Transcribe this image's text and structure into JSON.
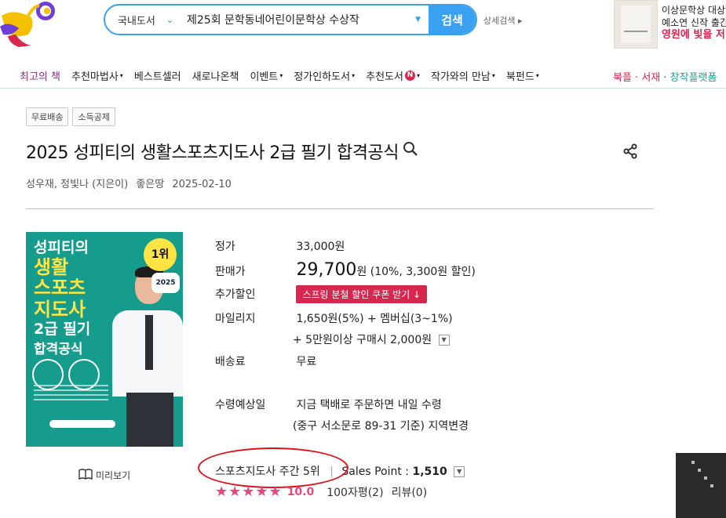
{
  "header": {
    "search": {
      "category": "국내도서",
      "query": "제25회 문학동네어린이문학상 수상작",
      "button": "검색"
    },
    "detail_search": "상세검색 ▸",
    "promo": {
      "line1": "이상문학상 대상",
      "line2": "예소연 신작 출간",
      "line3": "영원에 빛을 저"
    }
  },
  "nav": {
    "items": [
      {
        "label": "최고의 책",
        "caret": ""
      },
      {
        "label": "추천마법사",
        "caret": "▾"
      },
      {
        "label": "베스트셀러",
        "caret": ""
      },
      {
        "label": "새로나온책",
        "caret": ""
      },
      {
        "label": "이벤트",
        "caret": "▾"
      },
      {
        "label": "정가인하도서",
        "caret": "▾"
      },
      {
        "label": "추천도서",
        "caret": "▾",
        "badge": "N"
      },
      {
        "label": "작가와의 만남",
        "caret": "▾"
      },
      {
        "label": "북펀드",
        "caret": "▾"
      }
    ],
    "right_pink": "북플 · 서재 ·",
    "right_teal": "창작플랫폼"
  },
  "product": {
    "tags": [
      "무료배송",
      "소득공제"
    ],
    "title": "2025 성피티의 생활스포츠지도사 2급 필기 합격공식",
    "meta": {
      "authors": "성우재, 정빛나 (지은이)",
      "publisher": "좋은땅",
      "date": "2025-02-10"
    },
    "cover": {
      "line1": "성피티의",
      "line2": "생활",
      "line3": "스포츠",
      "line4": "지도사",
      "line5": "2급 필기",
      "line6": "합격공식",
      "rank_badge": "1위",
      "year_badge": "2025"
    },
    "preview_label": "미리보기",
    "info": {
      "list_price_label": "정가",
      "list_price": "33,000원",
      "sale_price_label": "판매가",
      "sale_price": "29,700",
      "sale_unit": "원",
      "sale_detail": "(10%, 3,300원 할인)",
      "extra_discount_label": "추가할인",
      "coupon_button": "스프링 분철 할인 쿠폰 받기 ↓",
      "mileage_label": "마일리지",
      "mileage_line1": "1,650원(5%) + 멤버십(3~1%)",
      "mileage_line2": "+ 5만원이상 구매시 2,000원",
      "shipping_label": "배송료",
      "shipping": "무료",
      "receive_label": "수령예상일",
      "receive_line1": "지금 택배로 주문하면 내일 수령",
      "receive_line2": "(중구 서소문로 89-31 기준) 지역변경"
    },
    "rank": {
      "text": "스포츠지도사 주간 5위",
      "sales_point_label": "Sales Point :",
      "sales_point": "1,510"
    },
    "rating": {
      "stars": "★★★★★",
      "score": "10.0",
      "short_reviews": "100자평(2)",
      "reviews": "리뷰(0)"
    }
  },
  "colors": {
    "accent_blue": "#3aa0f0",
    "pink": "#d8274f",
    "star_pink": "#e8467c",
    "cover_teal": "#159c8c",
    "cover_yellow": "#ffe443",
    "highlight_red": "#e0101a"
  }
}
